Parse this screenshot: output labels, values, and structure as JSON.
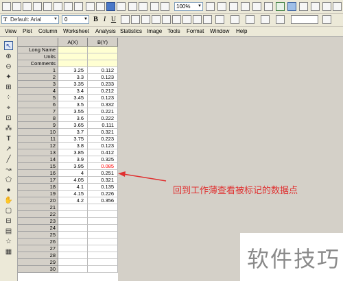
{
  "toolbar": {
    "zoom": "100%",
    "font_name": "Default: Arial",
    "font_size": "0",
    "bold": "B",
    "italic": "I",
    "underline": "U"
  },
  "menu": [
    "View",
    "Plot",
    "Column",
    "Worksheet",
    "Analysis",
    "Statistics",
    "Image",
    "Tools",
    "Format",
    "Window",
    "Help"
  ],
  "columns": [
    {
      "header": "A(X)"
    },
    {
      "header": "B(Y)"
    }
  ],
  "meta_rows": [
    "Long Name",
    "Units",
    "Comments"
  ],
  "rows": [
    {
      "n": "1",
      "a": "3.25",
      "b": "0.112"
    },
    {
      "n": "2",
      "a": "3.3",
      "b": "0.123"
    },
    {
      "n": "3",
      "a": "3.35",
      "b": "0.233"
    },
    {
      "n": "4",
      "a": "3.4",
      "b": "0.212"
    },
    {
      "n": "5",
      "a": "3.45",
      "b": "0.123"
    },
    {
      "n": "6",
      "a": "3.5",
      "b": "0.332"
    },
    {
      "n": "7",
      "a": "3.55",
      "b": "0.221"
    },
    {
      "n": "8",
      "a": "3.6",
      "b": "0.222"
    },
    {
      "n": "9",
      "a": "3.65",
      "b": "0.111"
    },
    {
      "n": "10",
      "a": "3.7",
      "b": "0.321"
    },
    {
      "n": "11",
      "a": "3.75",
      "b": "0.223"
    },
    {
      "n": "12",
      "a": "3.8",
      "b": "0.123"
    },
    {
      "n": "13",
      "a": "3.85",
      "b": "0.412"
    },
    {
      "n": "14",
      "a": "3.9",
      "b": "0.325"
    },
    {
      "n": "15",
      "a": "3.95",
      "b": "0.085",
      "marked": true
    },
    {
      "n": "16",
      "a": "4",
      "b": "0.251"
    },
    {
      "n": "17",
      "a": "4.05",
      "b": "0.321"
    },
    {
      "n": "18",
      "a": "4.1",
      "b": "0.135"
    },
    {
      "n": "19",
      "a": "4.15",
      "b": "0.226"
    },
    {
      "n": "20",
      "a": "4.2",
      "b": "0.356"
    },
    {
      "n": "21",
      "a": "",
      "b": ""
    },
    {
      "n": "22",
      "a": "",
      "b": ""
    },
    {
      "n": "23",
      "a": "",
      "b": ""
    },
    {
      "n": "24",
      "a": "",
      "b": ""
    },
    {
      "n": "25",
      "a": "",
      "b": ""
    },
    {
      "n": "26",
      "a": "",
      "b": ""
    },
    {
      "n": "27",
      "a": "",
      "b": ""
    },
    {
      "n": "28",
      "a": "",
      "b": ""
    },
    {
      "n": "29",
      "a": "",
      "b": ""
    },
    {
      "n": "30",
      "a": "",
      "b": ""
    }
  ],
  "annotation": "回到工作薄查看被标记的数据点",
  "watermark": "软件技巧",
  "colors": {
    "marked_value": "#ff0000",
    "annotation": "#e03030",
    "meta_row_bg": "#ffffd2"
  }
}
